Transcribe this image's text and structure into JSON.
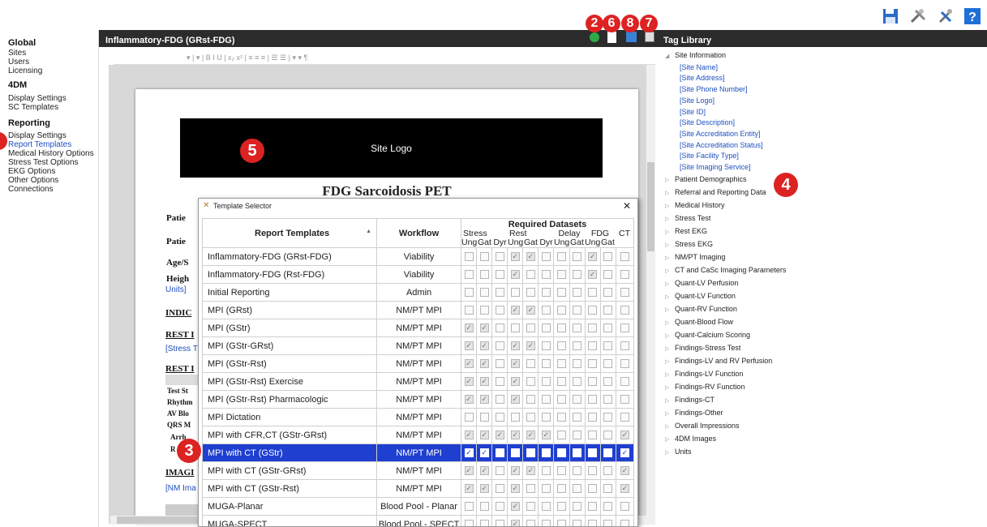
{
  "toolbar_icons": [
    "save-icon",
    "tools-icon",
    "settings-tools-icon",
    "help-icon"
  ],
  "sidebar": {
    "global": {
      "heading": "Global",
      "items": [
        "Sites",
        "Users",
        "Licensing"
      ]
    },
    "dm": {
      "heading": "4DM",
      "items": [
        "Display Settings",
        "SC Templates"
      ]
    },
    "reporting": {
      "heading": "Reporting",
      "items": [
        "Display Settings",
        "Report Templates",
        "Medical History Options",
        "Stress Test Options",
        "EKG Options",
        "Other Options",
        "Connections"
      ],
      "active": "Report Templates"
    }
  },
  "editor": {
    "title": "Inflammatory-FDG (GRst-FDG)",
    "toolbar_text": "▾   |  ▾ | B  I  U  | x₂ x² | ≡ ≡ ≡ | ☰ ☰ |                ▾     ▾ ¶",
    "site_logo": "Site Logo",
    "doc_title": "FDG Sarcoidosis PET",
    "partial_labels": [
      "Patie",
      "Patie",
      "Age/S",
      "Heigh",
      "INDIC",
      "REST I",
      "REST I",
      "Test St",
      "Rhythm",
      "AV Blo",
      "QRS M",
      "Arrh",
      "R",
      "IMAGI"
    ],
    "partial_links": [
      "Units]",
      "[Stress T",
      "[NM Ima"
    ]
  },
  "badges": {
    "b2": "2",
    "b6": "6",
    "b8": "8",
    "b7": "7",
    "b5": "5",
    "b3": "3",
    "b4": "4"
  },
  "dialog": {
    "title": "Template Selector",
    "close": "✕",
    "headers": {
      "templates": "Report Templates",
      "workflow": "Workflow",
      "required": "Required Datasets"
    },
    "groups": [
      "Stress",
      "Rest",
      "Delay",
      "FDG",
      "CT"
    ],
    "subheads": [
      "Ung",
      "Gat",
      "Dyr",
      "Ung",
      "Gat",
      "Dyr",
      "Ung",
      "Gat",
      "Ung",
      "Gat"
    ],
    "rows": [
      {
        "name": "Inflammatory-FDG (GRst-FDG)",
        "workflow": "Viability",
        "checks": [
          0,
          0,
          0,
          1,
          1,
          0,
          0,
          0,
          1,
          0,
          0
        ]
      },
      {
        "name": "Inflammatory-FDG (Rst-FDG)",
        "workflow": "Viability",
        "checks": [
          0,
          0,
          0,
          1,
          0,
          0,
          0,
          0,
          1,
          0,
          0
        ]
      },
      {
        "name": "Initial Reporting",
        "workflow": "Admin",
        "checks": [
          0,
          0,
          0,
          0,
          0,
          0,
          0,
          0,
          0,
          0,
          0
        ]
      },
      {
        "name": "MPI (GRst)",
        "workflow": "NM/PT MPI",
        "checks": [
          0,
          0,
          0,
          1,
          1,
          0,
          0,
          0,
          0,
          0,
          0
        ]
      },
      {
        "name": "MPI (GStr)",
        "workflow": "NM/PT MPI",
        "checks": [
          1,
          1,
          0,
          0,
          0,
          0,
          0,
          0,
          0,
          0,
          0
        ]
      },
      {
        "name": "MPI (GStr-GRst)",
        "workflow": "NM/PT MPI",
        "checks": [
          1,
          1,
          0,
          1,
          1,
          0,
          0,
          0,
          0,
          0,
          0
        ]
      },
      {
        "name": "MPI (GStr-Rst)",
        "workflow": "NM/PT MPI",
        "checks": [
          1,
          1,
          0,
          1,
          0,
          0,
          0,
          0,
          0,
          0,
          0
        ]
      },
      {
        "name": "MPI (GStr-Rst) Exercise",
        "workflow": "NM/PT MPI",
        "checks": [
          1,
          1,
          0,
          1,
          0,
          0,
          0,
          0,
          0,
          0,
          0
        ]
      },
      {
        "name": "MPI (GStr-Rst) Pharmacologic",
        "workflow": "NM/PT MPI",
        "checks": [
          1,
          1,
          0,
          1,
          0,
          0,
          0,
          0,
          0,
          0,
          0
        ]
      },
      {
        "name": "MPI Dictation",
        "workflow": "NM/PT MPI",
        "checks": [
          0,
          0,
          0,
          0,
          0,
          0,
          0,
          0,
          0,
          0,
          0
        ]
      },
      {
        "name": "MPI with CFR,CT (GStr-GRst)",
        "workflow": "NM/PT MPI",
        "checks": [
          1,
          1,
          1,
          1,
          1,
          1,
          0,
          0,
          0,
          0,
          1
        ]
      },
      {
        "name": "MPI with CT (GStr)",
        "workflow": "NM/PT MPI",
        "checks": [
          1,
          1,
          0,
          0,
          0,
          0,
          0,
          0,
          0,
          0,
          1
        ],
        "selected": true
      },
      {
        "name": "MPI with CT (GStr-GRst)",
        "workflow": "NM/PT MPI",
        "checks": [
          1,
          1,
          0,
          1,
          1,
          0,
          0,
          0,
          0,
          0,
          1
        ]
      },
      {
        "name": "MPI with CT (GStr-Rst)",
        "workflow": "NM/PT MPI",
        "checks": [
          1,
          1,
          0,
          1,
          0,
          0,
          0,
          0,
          0,
          0,
          1
        ]
      },
      {
        "name": "MUGA-Planar",
        "workflow": "Blood Pool - Planar",
        "checks": [
          0,
          0,
          0,
          1,
          0,
          0,
          0,
          0,
          0,
          0,
          0
        ]
      },
      {
        "name": "MUGA-SPECT",
        "workflow": "Blood Pool - SPECT",
        "checks": [
          0,
          0,
          0,
          1,
          0,
          0,
          0,
          0,
          0,
          0,
          0
        ]
      }
    ]
  },
  "tag_library": {
    "title": "Tag Library",
    "root": "Site Information",
    "site_tags": [
      "[Site Name]",
      "[Site Address]",
      "[Site Phone Number]",
      "[Site Logo]",
      "[Site ID]",
      "[Site Description]",
      "[Site Accreditation Entity]",
      "[Site Accreditation Status]",
      "[Site Facility Type]",
      "[Site Imaging Service]"
    ],
    "categories": [
      "Patient Demographics",
      "Referral and Reporting Data",
      "Medical History",
      "Stress Test",
      "Rest EKG",
      "Stress EKG",
      "NM/PT Imaging",
      "CT and CaSc Imaging Parameters",
      "Quant-LV Perfusion",
      "Quant-LV Function",
      "Quant-RV Function",
      "Quant-Blood Flow",
      "Quant-Calcium Scoring",
      "Findings-Stress Test",
      "Findings-LV and RV Perfusion",
      "Findings-LV Function",
      "Findings-RV Function",
      "Findings-CT",
      "Findings-Other",
      "Overall Impressions",
      "4DM Images",
      "Units"
    ]
  },
  "colors": {
    "accent": "#1f3fd0",
    "badge": "#dd2222",
    "link": "#1d4fbf",
    "bar": "#2c2c2c"
  }
}
